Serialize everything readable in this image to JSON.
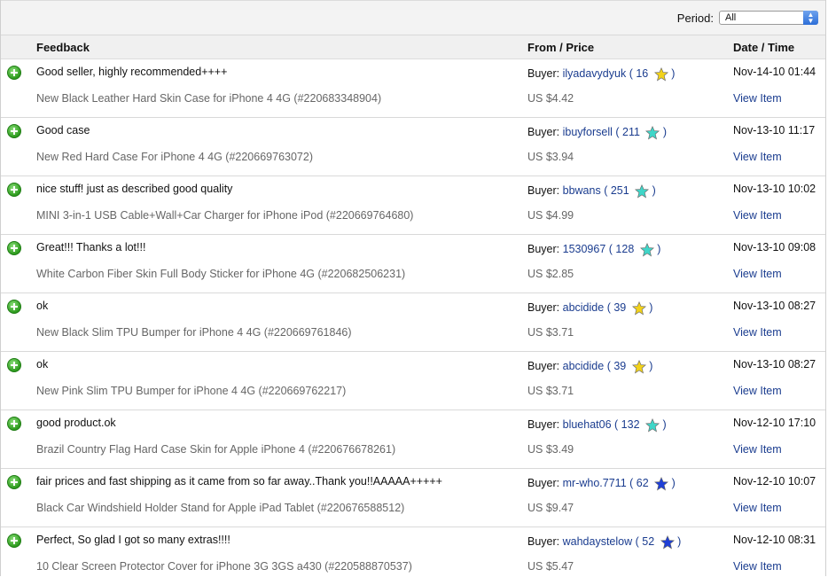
{
  "filter": {
    "period_label": "Period:",
    "period_value": "All"
  },
  "columns": {
    "feedback": "Feedback",
    "from_price": "From / Price",
    "date_time": "Date / Time"
  },
  "colors": {
    "link": "#1a3c8f",
    "yellow_star": "#f2d21b",
    "turquoise_star": "#3fd6c8",
    "blue_star": "#1f3fd6",
    "positive": "#2d9a1d"
  },
  "rows": [
    {
      "comment": "Good seller, highly recommended++++",
      "item": "New Black Leather Hard Skin Case for iPhone 4 4G (#220683348904)",
      "buyer_label": "Buyer:",
      "buyer": "ilyadavydyuk",
      "score": "16",
      "star": "yellow-star-icon",
      "price": "US $4.42",
      "date": "Nov-14-10 01:44",
      "view": "View Item"
    },
    {
      "comment": "Good case",
      "item": "New Red Hard Case For iPhone 4 4G (#220669763072)",
      "buyer_label": "Buyer:",
      "buyer": "ibuyforsell",
      "score": "211",
      "star": "turquoise-star-icon",
      "price": "US $3.94",
      "date": "Nov-13-10 11:17",
      "view": "View Item"
    },
    {
      "comment": "nice stuff! just as described good quality",
      "item": "MINI 3-in-1 USB Cable+Wall+Car Charger for iPhone iPod (#220669764680)",
      "buyer_label": "Buyer:",
      "buyer": "bbwans",
      "score": "251",
      "star": "turquoise-star-icon",
      "price": "US $4.99",
      "date": "Nov-13-10 10:02",
      "view": "View Item"
    },
    {
      "comment": "Great!!! Thanks a lot!!!",
      "item": "White Carbon Fiber Skin Full Body Sticker for iPhone 4G (#220682506231)",
      "buyer_label": "Buyer:",
      "buyer": "1530967",
      "score": "128",
      "star": "turquoise-star-icon",
      "price": "US $2.85",
      "date": "Nov-13-10 09:08",
      "view": "View Item"
    },
    {
      "comment": "ok",
      "item": "New Black Slim TPU Bumper for iPhone 4 4G (#220669761846)",
      "buyer_label": "Buyer:",
      "buyer": "abcidide",
      "score": "39",
      "star": "yellow-star-icon",
      "price": "US $3.71",
      "date": "Nov-13-10 08:27",
      "view": "View Item"
    },
    {
      "comment": "ok",
      "item": "New Pink Slim TPU Bumper for iPhone 4 4G (#220669762217)",
      "buyer_label": "Buyer:",
      "buyer": "abcidide",
      "score": "39",
      "star": "yellow-star-icon",
      "price": "US $3.71",
      "date": "Nov-13-10 08:27",
      "view": "View Item"
    },
    {
      "comment": "good product.ok",
      "item": "Brazil Country Flag Hard Case Skin for Apple iPhone 4 (#220676678261)",
      "buyer_label": "Buyer:",
      "buyer": "bluehat06",
      "score": "132",
      "star": "turquoise-star-icon",
      "price": "US $3.49",
      "date": "Nov-12-10 17:10",
      "view": "View Item"
    },
    {
      "comment": "fair prices and fast shipping as it came from so far away..Thank you!!AAAAA+++++",
      "item": "Black Car Windshield Holder Stand for Apple iPad Tablet (#220676588512)",
      "buyer_label": "Buyer:",
      "buyer": "mr-who.7711",
      "score": "62",
      "star": "blue-star-icon",
      "price": "US $9.47",
      "date": "Nov-12-10 10:07",
      "view": "View Item"
    },
    {
      "comment": "Perfect, So glad I got so many extras!!!!",
      "item": "10 Clear Screen Protector Cover for iPhone 3G 3GS a430 (#220588870537)",
      "buyer_label": "Buyer:",
      "buyer": "wahdaystelow",
      "score": "52",
      "star": "blue-star-icon",
      "price": "US $5.47",
      "date": "Nov-12-10 08:31",
      "view": "View Item"
    }
  ]
}
